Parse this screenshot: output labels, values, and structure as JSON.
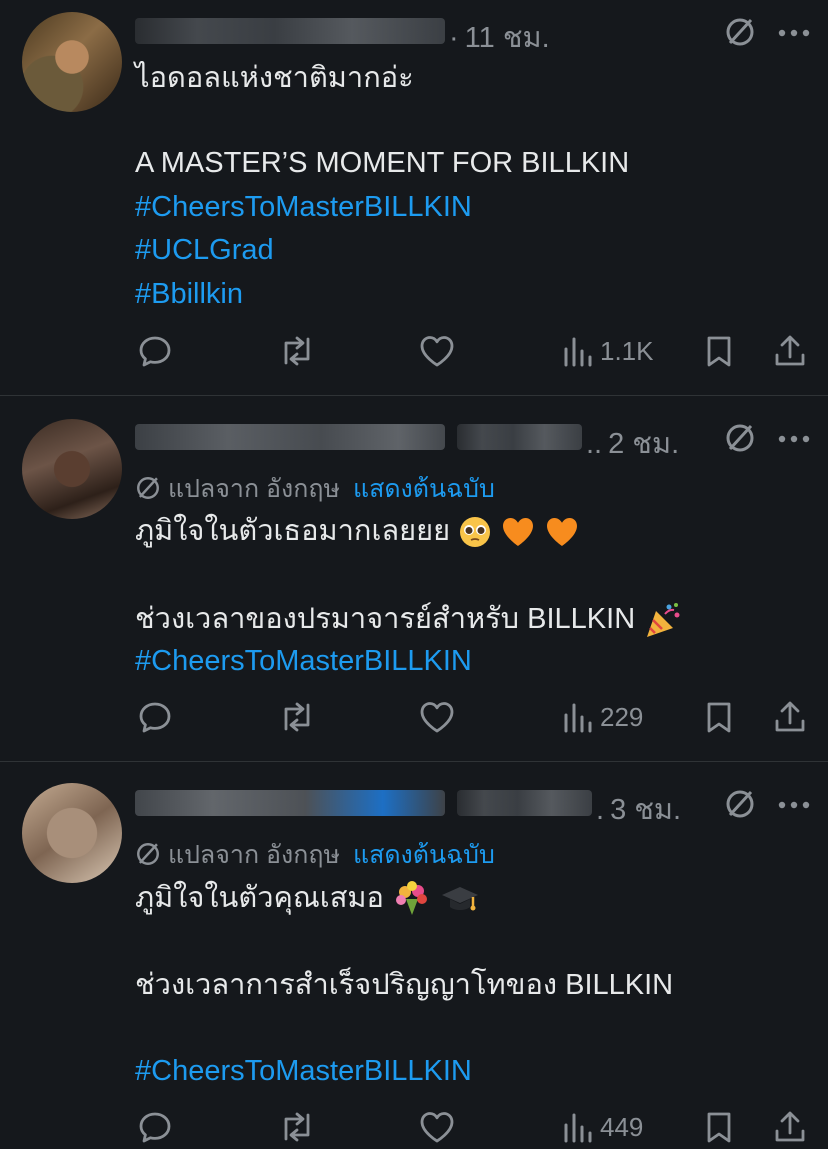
{
  "posts": [
    {
      "time": "11 ชม.",
      "translate": null,
      "lines": [
        {
          "text": "ไอดอลแห่งชาติมากอ่ะ",
          "tag": false
        },
        {
          "text": "",
          "tag": false
        },
        {
          "text": "A MASTER’S MOMENT FOR BILLKIN",
          "tag": false
        },
        {
          "text": "#CheersToMasterBILLKIN",
          "tag": true
        },
        {
          "text": "#UCLGrad",
          "tag": true
        },
        {
          "text": "#Bbillkin",
          "tag": true
        }
      ],
      "views": "1.1K"
    },
    {
      "time": "2 ชม.",
      "translate": {
        "label": "แปลจาก อังกฤษ",
        "action": "แสดงต้นฉบับ"
      },
      "lines": [
        {
          "text": "ภูมิใจในตัวเธอมากเลยยย",
          "tag": false
        },
        {
          "text": "",
          "tag": false
        },
        {
          "text": "ช่วงเวลาของปรมาจารย์สำหรับ BILLKIN",
          "tag": false
        },
        {
          "text": "#CheersToMasterBILLKIN",
          "tag": true
        }
      ],
      "views": "229"
    },
    {
      "time": "3 ชม.",
      "translate": {
        "label": "แปลจาก อังกฤษ",
        "action": "แสดงต้นฉบับ"
      },
      "lines": [
        {
          "text": "ภูมิใจในตัวคุณเสมอ",
          "tag": false
        },
        {
          "text": "",
          "tag": false
        },
        {
          "text": "ช่วงเวลาการสำเร็จปริญญาโทของ BILLKIN",
          "tag": false
        },
        {
          "text": "",
          "tag": false
        },
        {
          "text": "#CheersToMasterBILLKIN",
          "tag": true
        }
      ],
      "views": "449"
    }
  ],
  "icons": {
    "translate": "slashed-circle-icon",
    "more": "more-dots-icon",
    "reply": "reply-bubble-icon",
    "repost": "repost-icon",
    "like": "heart-icon",
    "views": "bar-chart-icon",
    "bookmark": "bookmark-icon",
    "share": "share-icon"
  },
  "colors": {
    "background": "#15181c",
    "text": "#e7e9ea",
    "muted": "#8b9096",
    "link": "#1d9bf0",
    "divider": "#2f3336"
  }
}
